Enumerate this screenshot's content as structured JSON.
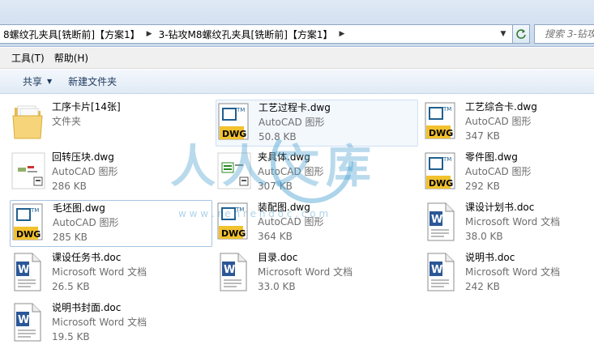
{
  "address": {
    "crumbs": [
      "8螺纹孔夹具[铣断前]【方案1】",
      "3-钻攻M8螺纹孔夹具[铣断前]【方案1】"
    ],
    "search_placeholder": "搜索 3-钻攻"
  },
  "menu": {
    "items": [
      "工具(T)",
      "帮助(H)"
    ]
  },
  "toolbar": {
    "share_label": "共享",
    "new_folder_label": "新建文件夹"
  },
  "files": [
    {
      "name": "工序卡片[14张]",
      "type": "文件夹",
      "size": "",
      "icon": "folder-icon"
    },
    {
      "name": "工艺过程卡.dwg",
      "type": "AutoCAD 图形",
      "size": "50.8 KB",
      "icon": "dwg-icon"
    },
    {
      "name": "工艺综合卡.dwg",
      "type": "AutoCAD 图形",
      "size": "347 KB",
      "icon": "dwg-icon"
    },
    {
      "name": "回转压块.dwg",
      "type": "AutoCAD 图形",
      "size": "286 KB",
      "icon": "dwg-thumbnail-icon"
    },
    {
      "name": "夹具体.dwg",
      "type": "AutoCAD 图形",
      "size": "307 KB",
      "icon": "dwg-thumbnail-icon"
    },
    {
      "name": "零件图.dwg",
      "type": "AutoCAD 图形",
      "size": "292 KB",
      "icon": "dwg-icon"
    },
    {
      "name": "毛坯图.dwg",
      "type": "AutoCAD 图形",
      "size": "285 KB",
      "icon": "dwg-icon"
    },
    {
      "name": "装配图.dwg",
      "type": "AutoCAD 图形",
      "size": "364 KB",
      "icon": "dwg-icon"
    },
    {
      "name": "课设计划书.doc",
      "type": "Microsoft Word 文档",
      "size": "38.0 KB",
      "icon": "word-doc-icon"
    },
    {
      "name": "课设任务书.doc",
      "type": "Microsoft Word 文档",
      "size": "26.5 KB",
      "icon": "word-doc-icon"
    },
    {
      "name": "目录.doc",
      "type": "Microsoft Word 文档",
      "size": "33.0 KB",
      "icon": "word-doc-icon"
    },
    {
      "name": "说明书.doc",
      "type": "Microsoft Word 文档",
      "size": "242 KB",
      "icon": "word-doc-icon"
    },
    {
      "name": "说明书封面.doc",
      "type": "Microsoft Word 文档",
      "size": "19.5 KB",
      "icon": "word-doc-icon"
    }
  ],
  "watermark": {
    "text": "人人文库",
    "url": "w w w . r e n r e n d o c . c o m"
  },
  "colors": {
    "toolbar_text": "#1e3a5f",
    "secondary_text": "#6d6d6d",
    "dwg_yellow": "#f2c12e",
    "word_blue": "#2b5797"
  }
}
